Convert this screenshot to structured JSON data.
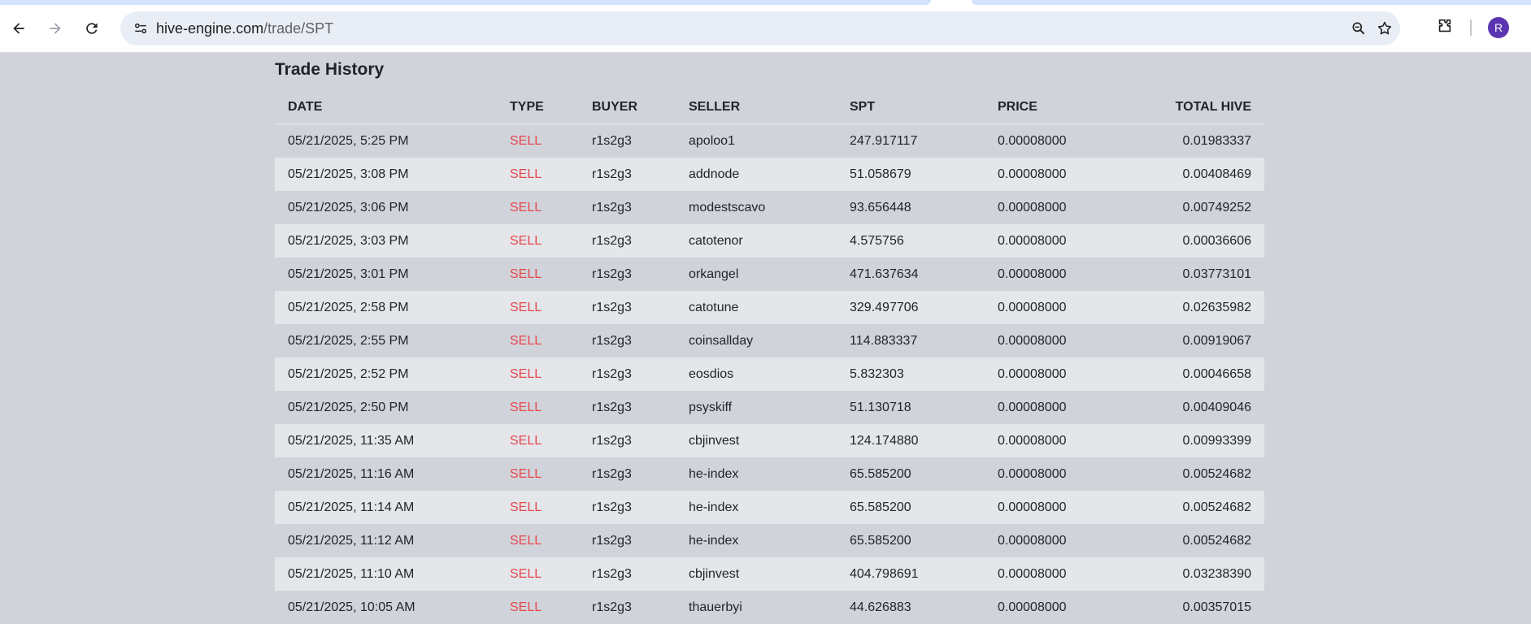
{
  "browser": {
    "url_domain": "hive-engine.com",
    "url_path": "/trade/SPT",
    "avatar_letter": "R"
  },
  "page": {
    "title": "Trade History"
  },
  "table": {
    "headers": [
      "DATE",
      "TYPE",
      "BUYER",
      "SELLER",
      "SPT",
      "PRICE",
      "TOTAL HIVE"
    ],
    "rows": [
      {
        "date": "05/21/2025, 5:25 PM",
        "type": "SELL",
        "buyer": "r1s2g3",
        "seller": "apoloo1",
        "spt": "247.917117",
        "price": "0.00008000",
        "total": "0.01983337"
      },
      {
        "date": "05/21/2025, 3:08 PM",
        "type": "SELL",
        "buyer": "r1s2g3",
        "seller": "addnode",
        "spt": "51.058679",
        "price": "0.00008000",
        "total": "0.00408469"
      },
      {
        "date": "05/21/2025, 3:06 PM",
        "type": "SELL",
        "buyer": "r1s2g3",
        "seller": "modestscavo",
        "spt": "93.656448",
        "price": "0.00008000",
        "total": "0.00749252"
      },
      {
        "date": "05/21/2025, 3:03 PM",
        "type": "SELL",
        "buyer": "r1s2g3",
        "seller": "catotenor",
        "spt": "4.575756",
        "price": "0.00008000",
        "total": "0.00036606"
      },
      {
        "date": "05/21/2025, 3:01 PM",
        "type": "SELL",
        "buyer": "r1s2g3",
        "seller": "orkangel",
        "spt": "471.637634",
        "price": "0.00008000",
        "total": "0.03773101"
      },
      {
        "date": "05/21/2025, 2:58 PM",
        "type": "SELL",
        "buyer": "r1s2g3",
        "seller": "catotune",
        "spt": "329.497706",
        "price": "0.00008000",
        "total": "0.02635982"
      },
      {
        "date": "05/21/2025, 2:55 PM",
        "type": "SELL",
        "buyer": "r1s2g3",
        "seller": "coinsallday",
        "spt": "114.883337",
        "price": "0.00008000",
        "total": "0.00919067"
      },
      {
        "date": "05/21/2025, 2:52 PM",
        "type": "SELL",
        "buyer": "r1s2g3",
        "seller": "eosdios",
        "spt": "5.832303",
        "price": "0.00008000",
        "total": "0.00046658"
      },
      {
        "date": "05/21/2025, 2:50 PM",
        "type": "SELL",
        "buyer": "r1s2g3",
        "seller": "psyskiff",
        "spt": "51.130718",
        "price": "0.00008000",
        "total": "0.00409046"
      },
      {
        "date": "05/21/2025, 11:35 AM",
        "type": "SELL",
        "buyer": "r1s2g3",
        "seller": "cbjinvest",
        "spt": "124.174880",
        "price": "0.00008000",
        "total": "0.00993399"
      },
      {
        "date": "05/21/2025, 11:16 AM",
        "type": "SELL",
        "buyer": "r1s2g3",
        "seller": "he-index",
        "spt": "65.585200",
        "price": "0.00008000",
        "total": "0.00524682"
      },
      {
        "date": "05/21/2025, 11:14 AM",
        "type": "SELL",
        "buyer": "r1s2g3",
        "seller": "he-index",
        "spt": "65.585200",
        "price": "0.00008000",
        "total": "0.00524682"
      },
      {
        "date": "05/21/2025, 11:12 AM",
        "type": "SELL",
        "buyer": "r1s2g3",
        "seller": "he-index",
        "spt": "65.585200",
        "price": "0.00008000",
        "total": "0.00524682"
      },
      {
        "date": "05/21/2025, 11:10 AM",
        "type": "SELL",
        "buyer": "r1s2g3",
        "seller": "cbjinvest",
        "spt": "404.798691",
        "price": "0.00008000",
        "total": "0.03238390"
      },
      {
        "date": "05/21/2025, 10:05 AM",
        "type": "SELL",
        "buyer": "r1s2g3",
        "seller": "thauerbyi",
        "spt": "44.626883",
        "price": "0.00008000",
        "total": "0.00357015"
      }
    ]
  },
  "colors": {
    "page_bg": "#d1d3da",
    "row_alt_bg": "#e4e6ea",
    "sell": "#e5484d",
    "avatar_bg": "#5b35b1"
  },
  "icons": {
    "back": "back-arrow-icon",
    "forward": "forward-arrow-icon",
    "reload": "reload-icon",
    "site_info": "tune-icon",
    "zoom": "zoom-icon",
    "bookmark": "star-icon",
    "extensions": "puzzle-icon"
  }
}
